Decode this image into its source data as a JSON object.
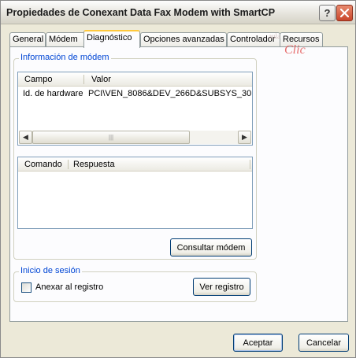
{
  "window": {
    "title": "Propiedades de Conexant Data Fax Modem with SmartCP",
    "help_glyph": "?",
    "close_glyph": "✕"
  },
  "tabs": [
    {
      "label": "General",
      "active": false
    },
    {
      "label": "Módem",
      "active": false
    },
    {
      "label": "Diagnóstico",
      "active": true
    },
    {
      "label": "Opciones avanzadas",
      "active": false
    },
    {
      "label": "Controlador",
      "active": false
    },
    {
      "label": "Recursos",
      "active": false
    }
  ],
  "watermark": {
    "small": "aula",
    "main": "Clic"
  },
  "modem_info": {
    "legend": "Información de módem",
    "columns": [
      "Campo",
      "Valor"
    ],
    "rows": [
      {
        "campo": "Id. de hardware",
        "valor": "PCI\\VEN_8086&DEV_266D&SUBSYS_30"
      }
    ],
    "scroll_left": "◀",
    "scroll_right": "▶",
    "thumb_grip": "|||"
  },
  "response_list": {
    "columns": [
      "Comando",
      "Respuesta"
    ]
  },
  "query_button": "Consultar módem",
  "session": {
    "legend": "Inicio de sesión",
    "checkbox_label": "Anexar al registro",
    "checked": false,
    "view_log_button": "Ver registro"
  },
  "footer": {
    "ok_button": "Aceptar",
    "cancel_button": "Cancelar"
  },
  "colors": {
    "accent": "#0046d5",
    "active_tab_highlight": "#ffc83c",
    "close_button": "#c9452a"
  }
}
